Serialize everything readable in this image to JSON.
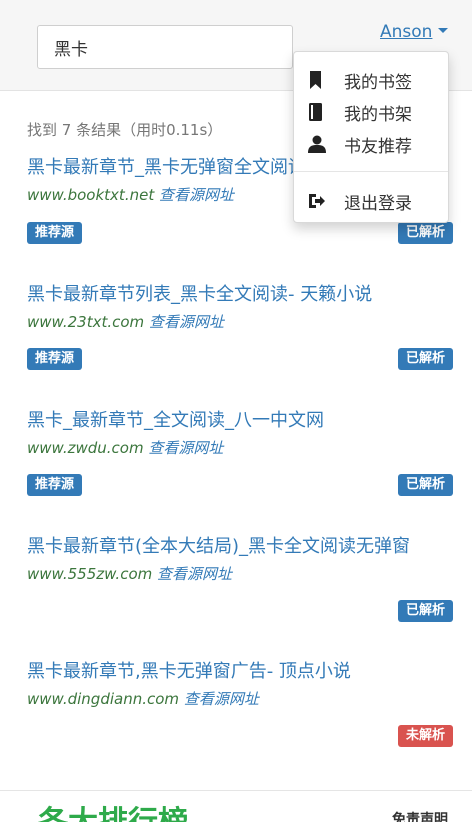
{
  "search": {
    "query": "黑卡"
  },
  "user_menu": {
    "username": "Anson",
    "items": [
      {
        "label": "我的书签",
        "icon": "bookmark-icon"
      },
      {
        "label": "我的书架",
        "icon": "book-icon"
      },
      {
        "label": "书友推荐",
        "icon": "user-icon"
      },
      {
        "label": "退出登录",
        "icon": "logout-icon"
      }
    ]
  },
  "summary": "找到 7 条结果（用时0.11s）",
  "view_source_label": "查看源网址",
  "badges": {
    "recommended": "推荐源",
    "parsed": "已解析",
    "unparsed": "未解析"
  },
  "results": [
    {
      "title": "黑卡最新章节_黑卡无弹窗全文阅读",
      "url": "www.booktxt.net",
      "recommended": true,
      "status": "parsed"
    },
    {
      "title": "黑卡最新章节列表_黑卡全文阅读- 天籁小说",
      "url": "www.23txt.com",
      "recommended": true,
      "status": "parsed"
    },
    {
      "title": "黑卡_最新章节_全文阅读_八一中文网",
      "url": "www.zwdu.com",
      "recommended": true,
      "status": "parsed"
    },
    {
      "title": "黑卡最新章节(全本大结局)_黑卡全文阅读无弹窗",
      "url": "www.555zw.com",
      "recommended": false,
      "status": "parsed"
    },
    {
      "title": "黑卡最新章节,黑卡无弹窗广告- 顶点小说",
      "url": "www.dingdiann.com",
      "recommended": false,
      "status": "unparsed"
    }
  ],
  "footer": {
    "rank_label": "各大排行榜",
    "disclaimer": "免责声明"
  },
  "colors": {
    "link": "#337ab7",
    "url_green": "#3c763d",
    "badge_blue": "#337ab7",
    "badge_red": "#d9534f",
    "rank_green": "#2eaa4a"
  }
}
